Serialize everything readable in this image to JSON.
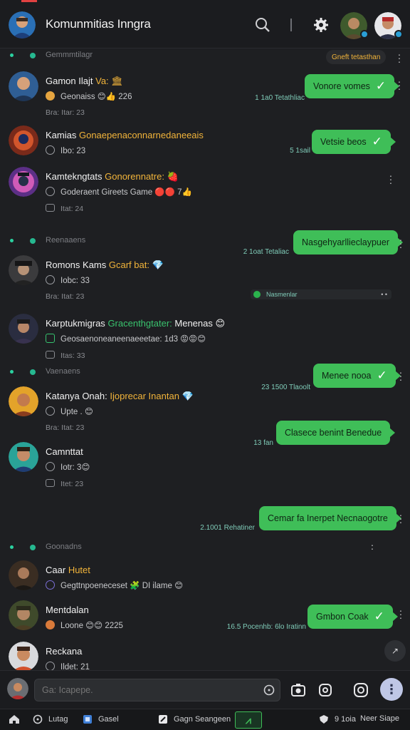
{
  "header": {
    "title": "Komunmitias Inngra",
    "icons": {
      "search": "search-icon",
      "settings": "gear-icon"
    }
  },
  "feed": {
    "sections": [
      {
        "label": "Gemmmtilagr",
        "tag": "Gneft tetasthan"
      },
      {
        "label": "Reenaaens"
      },
      {
        "label": "Vaenaens"
      },
      {
        "label": "Goonadns"
      }
    ],
    "threads": [
      {
        "name": "Gamon Ilajt",
        "highlight": "Va: 🏛",
        "sub": "Geonaiss 😊👍 226",
        "meta": "Bra: Itar: 23",
        "reply": "Vonore vomes",
        "reply_meta": "1 1a0 Tetathliac"
      },
      {
        "name": "Kamias",
        "highlight": "Gonaepenaconnarnedaneeais",
        "sub": "Ibo: 23",
        "meta": "",
        "reply": "Vetsie beos",
        "reply_meta": "5 1sail"
      },
      {
        "name": "Kamtekngtats",
        "highlight": "Gonorennatre: 🍓",
        "sub": "Goderaent Gireets  Game  🔴🔴 7👍",
        "meta": "Itat: 24",
        "reply": "Nasgehyarllieclaypuer",
        "reply_meta": "2 1oat Tetaliac"
      },
      {
        "name": "Romons Kams",
        "highlight": "Gcarf bat: 💎",
        "sub": "Iobc: 33",
        "meta": "Bra: Itat: 23",
        "link": "Nasmenlar"
      },
      {
        "name": "Karptukmigras",
        "highlight": "Gracenthgtater:",
        "tail": "Menenas 😊",
        "sub": "Geosaenoneaneenaeeetae: 1d3 😡😡😊",
        "meta": "Itas: 33",
        "reply": "",
        "reply_meta": ""
      },
      {
        "name": "Katanya Onah:",
        "highlight": "Ijoprecar Inantan 💎",
        "sub": "Upte .  😊",
        "meta": "Bra: Itat: 23",
        "reply": "Menee nooa",
        "reply_meta": "23 1500 Tlaoolt"
      },
      {
        "name": "Camnttat",
        "highlight": "",
        "sub": "Iotr: 3😊",
        "meta": "Itet: 23",
        "reply": "Clasece benint Benedue",
        "reply_meta": "13 fan"
      },
      {
        "reply": "Cemar fa Inerpet Necnaogotre",
        "reply_meta": "2.1001 Rehatiner"
      },
      {
        "name": "Caar",
        "highlight": "Hutet",
        "sub": "Gegttnpoeneceset  🧩  DI  ilame  😊",
        "meta": ""
      },
      {
        "name": "Mentdalan",
        "highlight": "",
        "sub": "Loone 😊😊 2225",
        "meta": "",
        "reply": "Gmbon Coak",
        "reply_meta": "16.5 Pocenhb: 6lo Iratinn"
      },
      {
        "name": "Reckana",
        "highlight": "",
        "sub": "Ildet: 21",
        "meta": ""
      }
    ]
  },
  "composer": {
    "placeholder": "Ga: Icapepe.",
    "icons": [
      "clock-icon",
      "camera-icon",
      "gif-icon",
      "sticker-icon"
    ],
    "send_glyph": "⋮"
  },
  "navbar": {
    "items": [
      {
        "label": "",
        "icon": "home-icon"
      },
      {
        "label": "Lutag",
        "icon": "clock-icon"
      },
      {
        "label": "Gasel",
        "icon": "box-icon"
      },
      {
        "label": "Gagn Seangeen",
        "icon": "pen-icon"
      },
      {
        "label": "",
        "icon": "active-tab-icon"
      },
      {
        "label": "9 1oia",
        "icon": "shield-icon"
      },
      {
        "label": "Neer Siape",
        "icon": ""
      }
    ]
  },
  "colors": {
    "accent": "#3fbe58",
    "highlight": "#f2b43a",
    "bg": "#1e1f22"
  }
}
